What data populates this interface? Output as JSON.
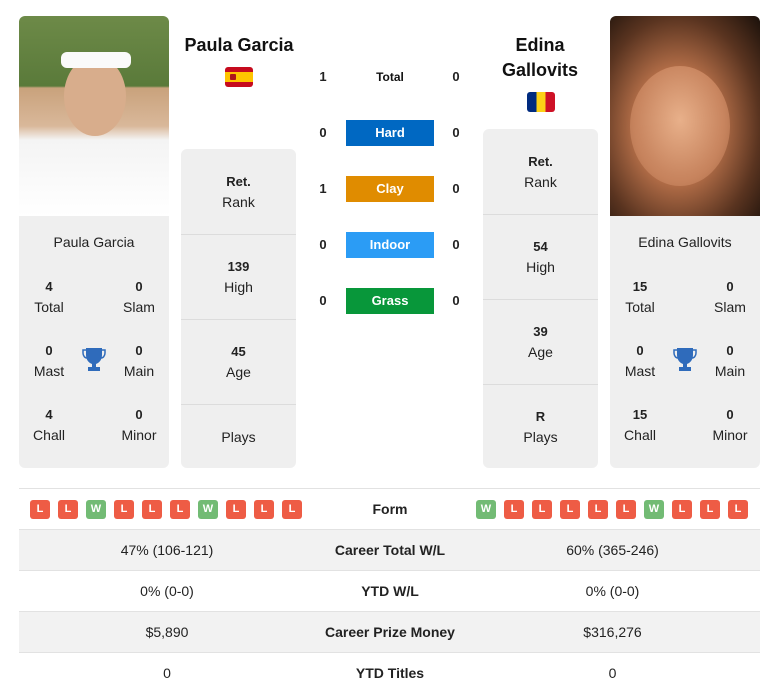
{
  "colors": {
    "hard": "#0068c2",
    "clay": "#e08c00",
    "indoor": "#2b9cf5",
    "grass": "#08973a",
    "loss": "#ee5c45",
    "win": "#72bb74",
    "trophy": "#2f6bbb"
  },
  "left_player": {
    "name": "Paula Garcia",
    "flag": "spain-flag",
    "card_name": "Paula Garcia",
    "stats": {
      "total": {
        "value": "4",
        "label": "Total"
      },
      "slam": {
        "value": "0",
        "label": "Slam"
      },
      "mast": {
        "value": "0",
        "label": "Mast"
      },
      "main": {
        "value": "0",
        "label": "Main"
      },
      "chall": {
        "value": "4",
        "label": "Chall"
      },
      "minor": {
        "value": "0",
        "label": "Minor"
      }
    },
    "info": [
      {
        "value": "Ret.",
        "label": "Rank"
      },
      {
        "value": "139",
        "label": "High"
      },
      {
        "value": "45",
        "label": "Age"
      },
      {
        "value": "",
        "label": "Plays"
      }
    ],
    "form": [
      "L",
      "L",
      "W",
      "L",
      "L",
      "L",
      "W",
      "L",
      "L",
      "L"
    ]
  },
  "right_player": {
    "name": "Edina Gallovits",
    "flag": "romania-flag",
    "card_name": "Edina Gallovits",
    "stats": {
      "total": {
        "value": "15",
        "label": "Total"
      },
      "slam": {
        "value": "0",
        "label": "Slam"
      },
      "mast": {
        "value": "0",
        "label": "Mast"
      },
      "main": {
        "value": "0",
        "label": "Main"
      },
      "chall": {
        "value": "15",
        "label": "Chall"
      },
      "minor": {
        "value": "0",
        "label": "Minor"
      }
    },
    "info": [
      {
        "value": "Ret.",
        "label": "Rank"
      },
      {
        "value": "54",
        "label": "High"
      },
      {
        "value": "39",
        "label": "Age"
      },
      {
        "value": "R",
        "label": "Plays"
      }
    ],
    "form": [
      "W",
      "L",
      "L",
      "L",
      "L",
      "L",
      "W",
      "L",
      "L",
      "L"
    ]
  },
  "h2h": [
    {
      "surface": "Total",
      "left": "1",
      "right": "0"
    },
    {
      "surface": "Hard",
      "left": "0",
      "right": "0"
    },
    {
      "surface": "Clay",
      "left": "1",
      "right": "0"
    },
    {
      "surface": "Indoor",
      "left": "0",
      "right": "0"
    },
    {
      "surface": "Grass",
      "left": "0",
      "right": "0"
    }
  ],
  "comparison": {
    "form_label": "Form",
    "rows": [
      {
        "label": "Career Total W/L",
        "left": "47% (106-121)",
        "right": "60% (365-246)"
      },
      {
        "label": "YTD W/L",
        "left": "0% (0-0)",
        "right": "0% (0-0)"
      },
      {
        "label": "Career Prize Money",
        "left": "$5,890",
        "right": "$316,276"
      },
      {
        "label": "YTD Titles",
        "left": "0",
        "right": "0"
      }
    ]
  }
}
